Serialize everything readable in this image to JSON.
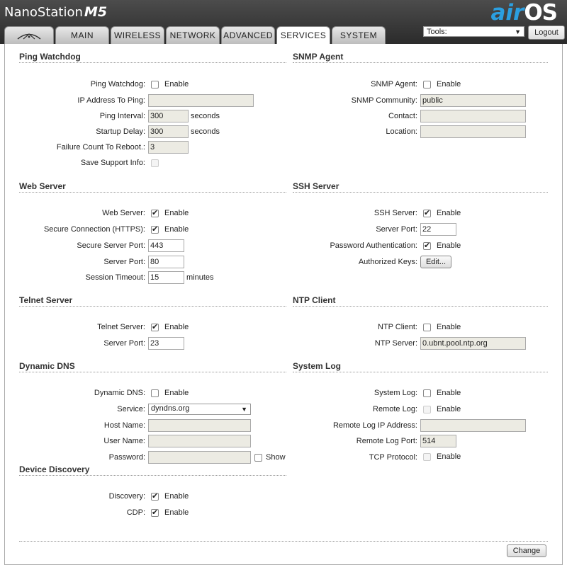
{
  "header": {
    "brand_name": "NanoStation",
    "brand_model": "M5",
    "logo_air": "air",
    "logo_os": "OS"
  },
  "tabs": [
    {
      "label": ""
    },
    {
      "label": "MAIN"
    },
    {
      "label": "WIRELESS"
    },
    {
      "label": "NETWORK"
    },
    {
      "label": "ADVANCED"
    },
    {
      "label": "SERVICES"
    },
    {
      "label": "SYSTEM"
    }
  ],
  "tools": {
    "label": "Tools:"
  },
  "logout": {
    "label": "Logout"
  },
  "ping": {
    "title": "Ping Watchdog",
    "enable_label": "Ping Watchdog:",
    "enable_text": "Enable",
    "ip_label": "IP Address To Ping:",
    "ip_value": "",
    "interval_label": "Ping Interval:",
    "interval_value": "300",
    "interval_unit": "seconds",
    "delay_label": "Startup Delay:",
    "delay_value": "300",
    "delay_unit": "seconds",
    "failure_label": "Failure Count To Reboot.:",
    "failure_value": "3",
    "support_label": "Save Support Info:"
  },
  "snmp": {
    "title": "SNMP Agent",
    "agent_label": "SNMP Agent:",
    "agent_text": "Enable",
    "community_label": "SNMP Community:",
    "community_value": "public",
    "contact_label": "Contact:",
    "contact_value": "",
    "location_label": "Location:",
    "location_value": ""
  },
  "web": {
    "title": "Web Server",
    "server_label": "Web Server:",
    "server_text": "Enable",
    "https_label": "Secure Connection (HTTPS):",
    "https_text": "Enable",
    "secure_port_label": "Secure Server Port:",
    "secure_port_value": "443",
    "port_label": "Server Port:",
    "port_value": "80",
    "timeout_label": "Session Timeout:",
    "timeout_value": "15",
    "timeout_unit": "minutes"
  },
  "ssh": {
    "title": "SSH Server",
    "server_label": "SSH Server:",
    "server_text": "Enable",
    "port_label": "Server Port:",
    "port_value": "22",
    "pwauth_label": "Password Authentication:",
    "pwauth_text": "Enable",
    "keys_label": "Authorized Keys:",
    "keys_button": "Edit..."
  },
  "telnet": {
    "title": "Telnet Server",
    "server_label": "Telnet Server:",
    "server_text": "Enable",
    "port_label": "Server Port:",
    "port_value": "23"
  },
  "ntp": {
    "title": "NTP Client",
    "client_label": "NTP Client:",
    "client_text": "Enable",
    "server_label": "NTP Server:",
    "server_value": "0.ubnt.pool.ntp.org"
  },
  "ddns": {
    "title": "Dynamic DNS",
    "enable_label": "Dynamic DNS:",
    "enable_text": "Enable",
    "service_label": "Service:",
    "service_value": "dyndns.org",
    "host_label": "Host Name:",
    "host_value": "",
    "user_label": "User Name:",
    "user_value": "",
    "pass_label": "Password:",
    "pass_value": "",
    "show_text": "Show"
  },
  "syslog": {
    "title": "System Log",
    "log_label": "System Log:",
    "log_text": "Enable",
    "remote_label": "Remote Log:",
    "remote_text": "Enable",
    "remote_ip_label": "Remote Log IP Address:",
    "remote_ip_value": "",
    "remote_port_label": "Remote Log Port:",
    "remote_port_value": "514",
    "tcp_label": "TCP Protocol:",
    "tcp_text": "Enable"
  },
  "discovery": {
    "title": "Device Discovery",
    "discovery_label": "Discovery:",
    "discovery_text": "Enable",
    "cdp_label": "CDP:",
    "cdp_text": "Enable"
  },
  "footer": {
    "change_button": "Change"
  }
}
